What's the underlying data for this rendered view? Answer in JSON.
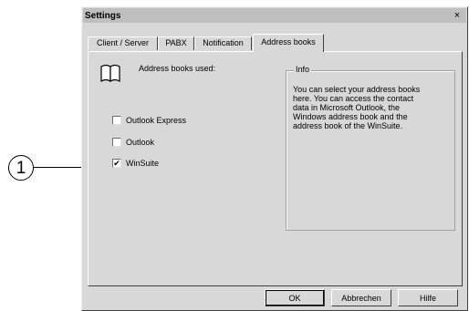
{
  "callout": {
    "number": "1"
  },
  "window": {
    "title": "Settings",
    "close_glyph": "×"
  },
  "tabs": [
    {
      "label": "Client / Server",
      "active": false
    },
    {
      "label": "PABX",
      "active": false
    },
    {
      "label": "Notification",
      "active": false
    },
    {
      "label": "Address books",
      "active": true
    }
  ],
  "address_books": {
    "label": "Address books used:",
    "icon": "book-icon",
    "options": [
      {
        "label": "Outlook Express",
        "checked": false
      },
      {
        "label": "Outlook",
        "checked": false
      },
      {
        "label": "WinSuite",
        "checked": true
      }
    ]
  },
  "info": {
    "legend": "Info",
    "text": "You can select your address books\nhere. You can access the contact\ndata in Microsoft Outlook, the\nWindows address book and the\naddress book of the WinSuite."
  },
  "buttons": {
    "ok": "OK",
    "cancel": "Abbrechen",
    "help": "Hilfe"
  },
  "check_glyph": "✔"
}
